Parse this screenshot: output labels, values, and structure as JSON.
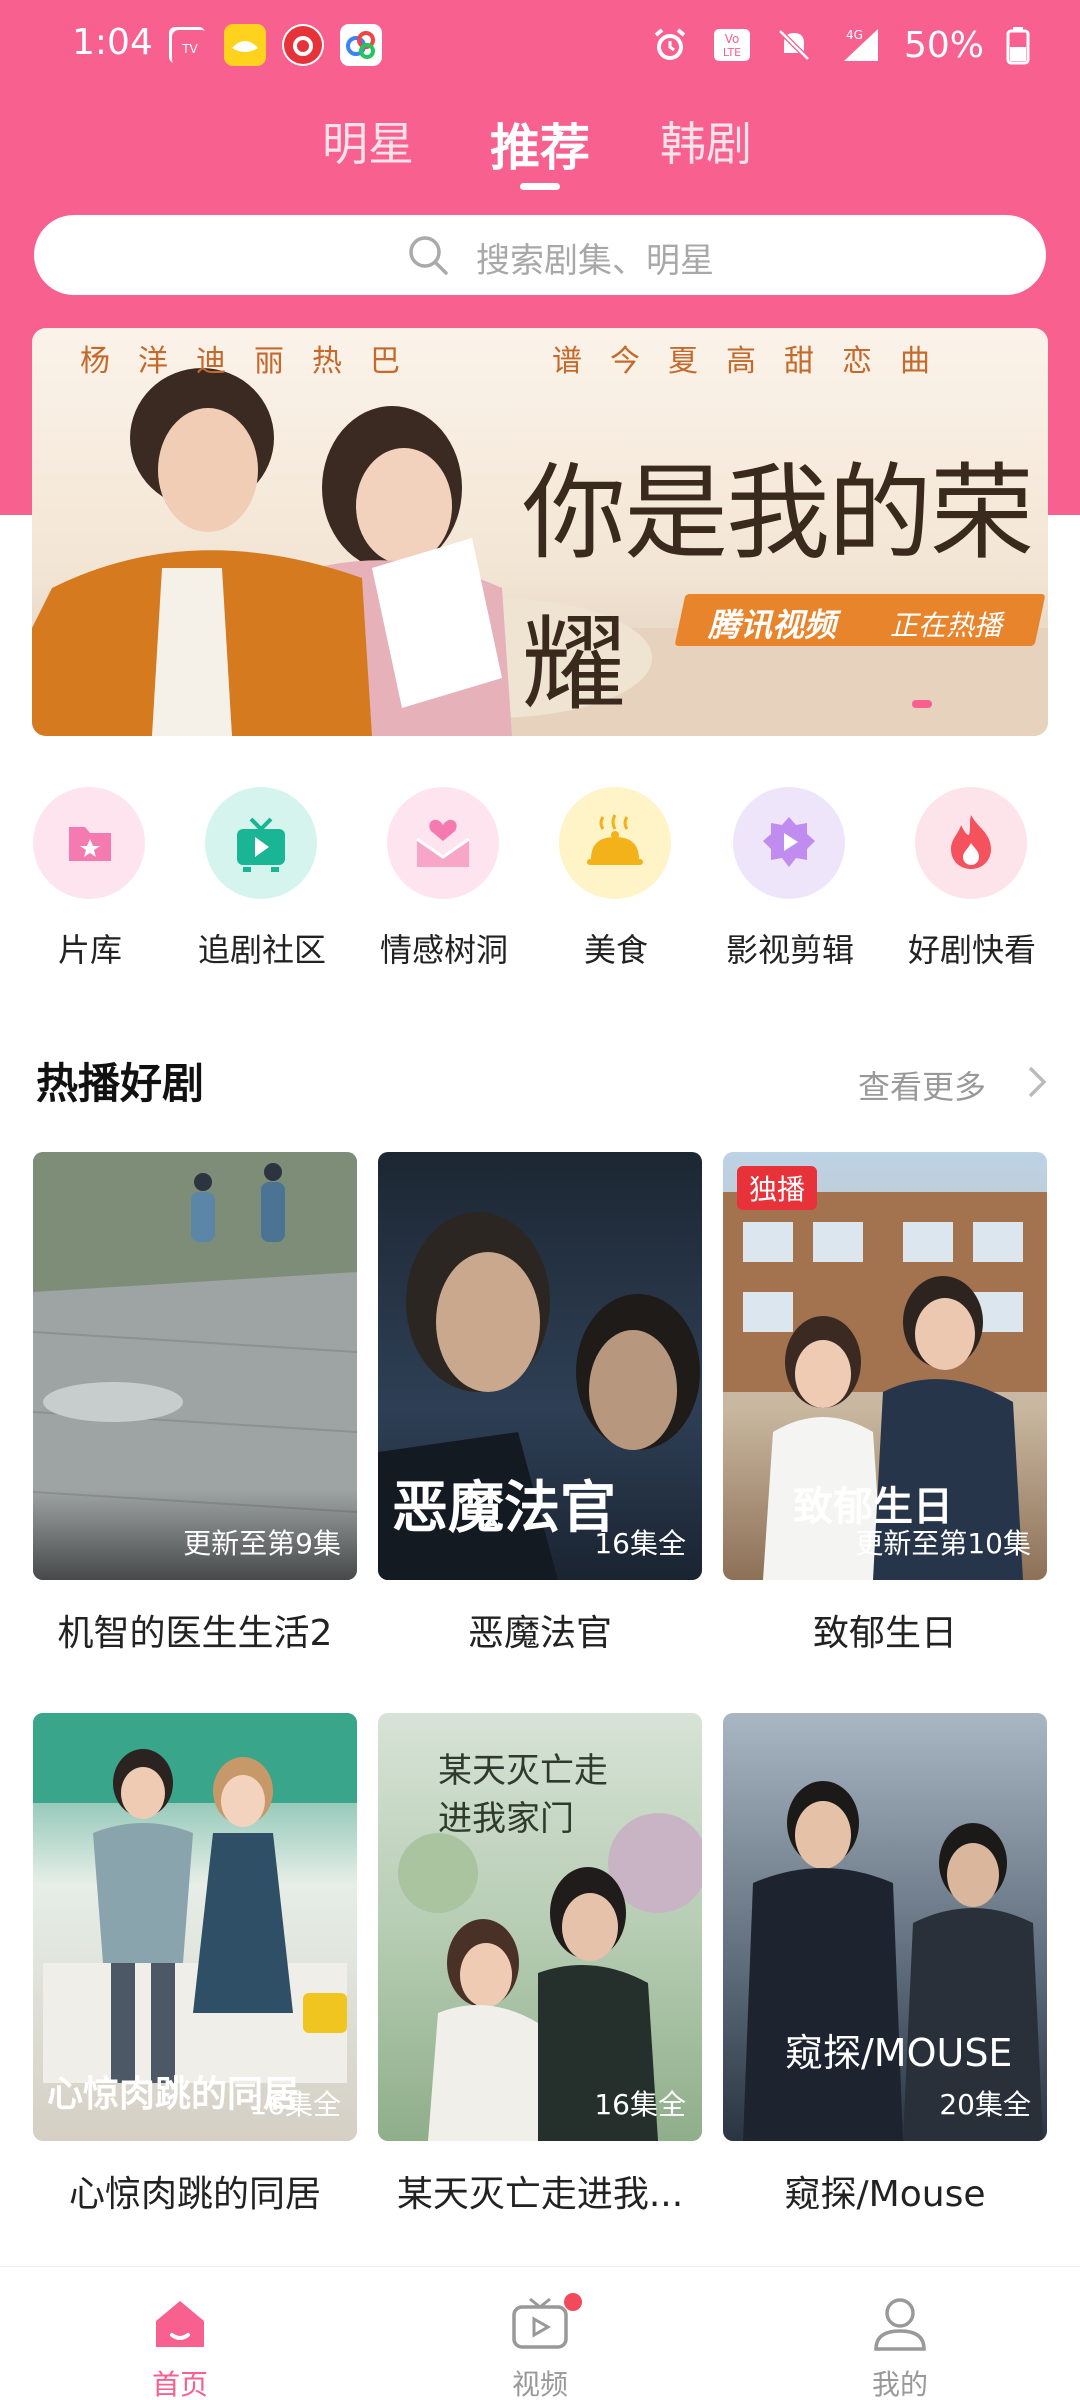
{
  "status_bar": {
    "time": "1:04",
    "app_icons": [
      "hanju-tv-icon",
      "yellow-app-icon",
      "netease-music-icon",
      "cloud-drive-icon"
    ],
    "indicators": [
      "alarm-icon",
      "volte-icon",
      "mute-icon",
      "signal-4g-icon",
      "battery-icon"
    ],
    "volte_label": "Vo LTE",
    "network_label": "4G",
    "battery": "50%"
  },
  "top_tabs": [
    "明星",
    "推荐",
    "韩剧"
  ],
  "active_tab": "推荐",
  "search": {
    "placeholder": "搜索剧集、明星"
  },
  "banner": {
    "subtitle_left": "杨洋迪丽热巴",
    "subtitle_right": "谱今夏高甜恋曲",
    "title": "你是我的荣耀",
    "tag_platform": "腾讯视频",
    "tag_status": "正在热播"
  },
  "categories": [
    {
      "label": "片库",
      "icon": "folder-star-icon",
      "color": "#fde4ee"
    },
    {
      "label": "追剧社区",
      "icon": "tv-icon",
      "color": "#d9f5ef"
    },
    {
      "label": "情感树洞",
      "icon": "heart-envelope-icon",
      "color": "#fde4ee"
    },
    {
      "label": "美食",
      "icon": "food-cloche-icon",
      "color": "#fff4cc"
    },
    {
      "label": "影视剪辑",
      "icon": "play-badge-icon",
      "color": "#efe6fb"
    },
    {
      "label": "好剧快看",
      "icon": "flame-icon",
      "color": "#fde4ee"
    }
  ],
  "section": {
    "title": "热播好剧",
    "see_more": "查看更多"
  },
  "dramas": [
    {
      "title": "机智的医生生活2",
      "badge": "更新至第9集",
      "poster_text": "",
      "exclusive": ""
    },
    {
      "title": "恶魔法官",
      "badge": "16集全",
      "poster_text": "恶魔法官",
      "exclusive": ""
    },
    {
      "title": "致郁生日",
      "badge": "更新至第10集",
      "poster_text": "致郁生日",
      "exclusive": "独播"
    },
    {
      "title": "心惊肉跳的同居",
      "badge": "16集全",
      "poster_text": "心惊肉跳的同居",
      "exclusive": ""
    },
    {
      "title": "某天灭亡走进我...",
      "badge": "16集全",
      "poster_text": "某天灭亡走进我家门",
      "exclusive": ""
    },
    {
      "title": "窥探/Mouse",
      "badge": "20集全",
      "poster_text": "窥探/MOUSE",
      "exclusive": ""
    }
  ],
  "bottom_nav": [
    {
      "label": "首页",
      "icon": "home-icon"
    },
    {
      "label": "视频",
      "icon": "video-tv-icon"
    },
    {
      "label": "我的",
      "icon": "profile-icon"
    }
  ],
  "colors": {
    "brand_pink": "#f7608f",
    "red_badge": "#e8323a"
  }
}
